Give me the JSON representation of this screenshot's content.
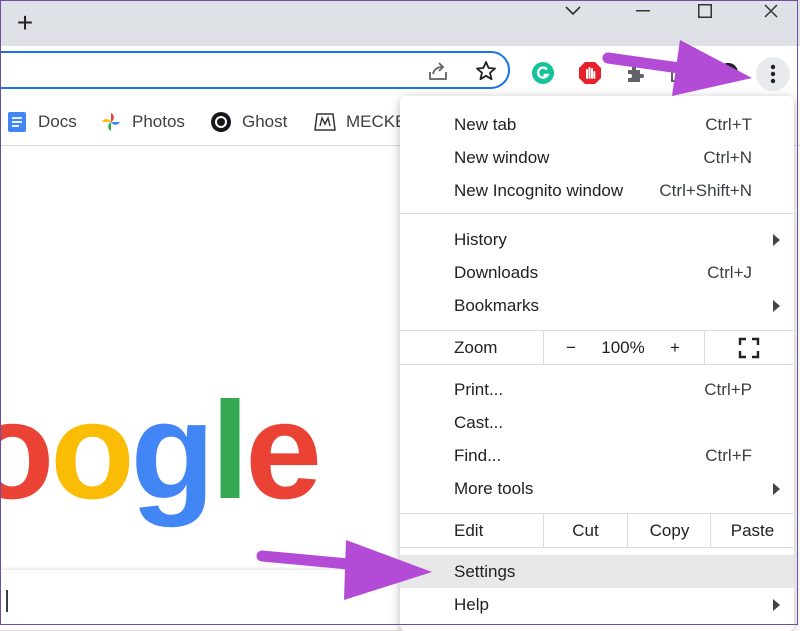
{
  "tab_strip": {
    "new_tab_symbol": "+",
    "window_controls": [
      "chevron-down",
      "minimize",
      "maximize",
      "close"
    ]
  },
  "toolbar": {
    "omnibox_icons": [
      "share-icon",
      "bookmark-star-icon"
    ],
    "extensions": [
      "grammarly-icon",
      "adblock-icon",
      "extensions-puzzle-icon",
      "reading-list-icon",
      "profile-icon"
    ],
    "menu_button": "more-options-icon"
  },
  "bookmarks": [
    {
      "label": "Docs",
      "icon": "docs-icon"
    },
    {
      "label": "Photos",
      "icon": "photos-icon"
    },
    {
      "label": "Ghost",
      "icon": "ghost-icon"
    },
    {
      "label": "MECKE",
      "icon": "mecke-icon"
    }
  ],
  "page": {
    "logo_letters": [
      "o",
      "o",
      "g",
      "l",
      "e"
    ],
    "logo_colors": [
      "#ea4335",
      "#fbbc05",
      "#4285f4",
      "#34a853",
      "#ea4335"
    ]
  },
  "menu": {
    "group1": [
      {
        "label": "New tab",
        "shortcut": "Ctrl+T"
      },
      {
        "label": "New window",
        "shortcut": "Ctrl+N"
      },
      {
        "label": "New Incognito window",
        "shortcut": "Ctrl+Shift+N"
      }
    ],
    "group2": [
      {
        "label": "History",
        "shortcut": ""
      },
      {
        "label": "Downloads",
        "shortcut": "Ctrl+J"
      },
      {
        "label": "Bookmarks",
        "shortcut": ""
      }
    ],
    "zoom": {
      "label": "Zoom",
      "minus": "−",
      "value": "100%",
      "plus": "+"
    },
    "group3": [
      {
        "label": "Print...",
        "shortcut": "Ctrl+P"
      },
      {
        "label": "Cast...",
        "shortcut": ""
      },
      {
        "label": "Find...",
        "shortcut": "Ctrl+F"
      },
      {
        "label": "More tools",
        "shortcut": ""
      }
    ],
    "edit": {
      "label": "Edit",
      "cut": "Cut",
      "copy": "Copy",
      "paste": "Paste"
    },
    "group4": [
      {
        "label": "Settings",
        "shortcut": ""
      },
      {
        "label": "Help",
        "shortcut": ""
      }
    ]
  },
  "annotations": {
    "arrow_color": "#b34bd6"
  }
}
